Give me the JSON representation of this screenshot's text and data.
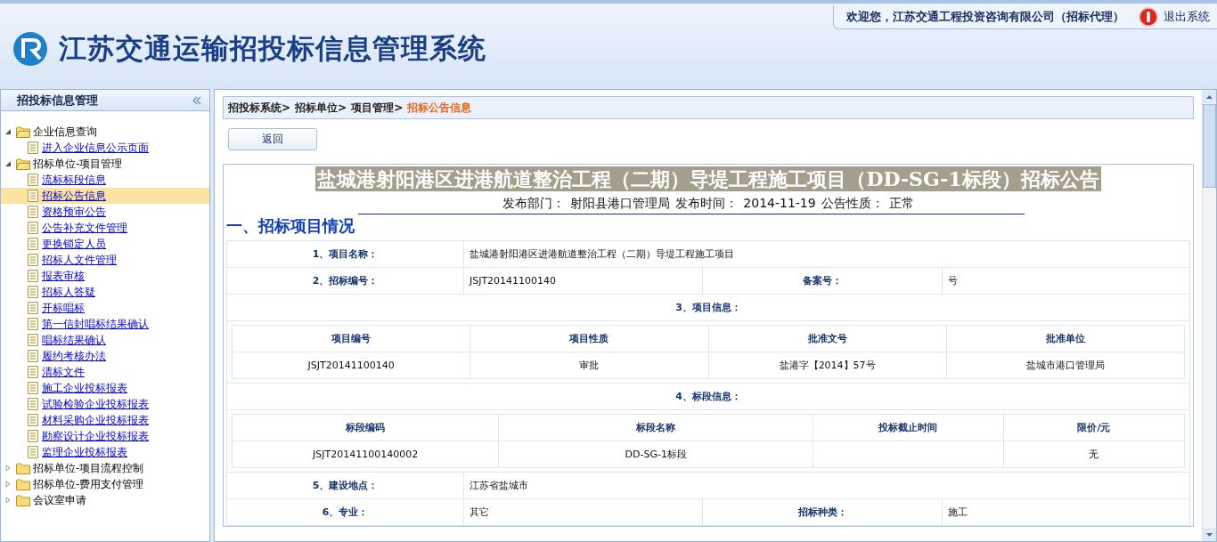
{
  "header": {
    "title": "江苏交通运输招投标信息管理系统",
    "welcome": "欢迎您，江苏交通工程投资咨询有限公司（招标代理）",
    "logout": "退出系统"
  },
  "sidebar": {
    "title": "招投标信息管理",
    "tree": [
      {
        "label": "企业信息查询",
        "expanded": true,
        "children": [
          {
            "label": "进入企业信息公示页面",
            "selected": false
          }
        ]
      },
      {
        "label": "招标单位-项目管理",
        "expanded": true,
        "children": [
          {
            "label": "流标标段信息",
            "selected": false
          },
          {
            "label": "招标公告信息",
            "selected": true
          },
          {
            "label": "资格预审公告",
            "selected": false
          },
          {
            "label": "公告补充文件管理",
            "selected": false
          },
          {
            "label": "更换锁定人员",
            "selected": false
          },
          {
            "label": "招标人文件管理",
            "selected": false
          },
          {
            "label": "报表审核",
            "selected": false
          },
          {
            "label": "招标人答疑",
            "selected": false
          },
          {
            "label": "开标唱标",
            "selected": false
          },
          {
            "label": "第一信封唱标结果确认",
            "selected": false
          },
          {
            "label": "唱标结果确认",
            "selected": false
          },
          {
            "label": "履约考核办法",
            "selected": false
          },
          {
            "label": "清标文件",
            "selected": false
          },
          {
            "label": "施工企业投标报表",
            "selected": false
          },
          {
            "label": "试验检验企业投标报表",
            "selected": false
          },
          {
            "label": "材料采购企业投标报表",
            "selected": false
          },
          {
            "label": "勘察设计企业投标报表",
            "selected": false
          },
          {
            "label": "监理企业投标报表",
            "selected": false
          }
        ]
      },
      {
        "label": "招标单位-项目流程控制",
        "expanded": false
      },
      {
        "label": "招标单位-费用支付管理",
        "expanded": false
      },
      {
        "label": "会议室申请",
        "expanded": false
      }
    ]
  },
  "breadcrumb": [
    {
      "label": "招投标系统>",
      "selected": false
    },
    {
      "label": "招标单位>",
      "selected": false
    },
    {
      "label": "项目管理>",
      "selected": false
    },
    {
      "label": "招标公告信息",
      "selected": true
    }
  ],
  "back_button": "返回",
  "notice": {
    "title": "盐城港射阳港区进港航道整治工程（二期）导堤工程施工项目（DD-SG-1标段）招标公告",
    "meta": [
      {
        "label": "发布部门：",
        "value": "射阳县港口管理局"
      },
      {
        "label": "发布时间：",
        "value": "2014-11-19"
      },
      {
        "label": "公告性质：",
        "value": "正常"
      }
    ],
    "section_heading": "一、招标项目情况",
    "rows": [
      {
        "kind": "field",
        "label": "1、项目名称：",
        "value": "盐城港射阳港区进港航道整治工程（二期）导堤工程施工项目"
      },
      {
        "kind": "field_pair",
        "label": "2、招标编号：",
        "value": "JSJT20141100140",
        "label_2": "备案号：",
        "value_2": "号"
      },
      {
        "kind": "section",
        "label": "3、项目信息："
      },
      {
        "kind": "subtable",
        "columns": [
          "项目编号",
          "项目性质",
          "批准文号",
          "批准单位"
        ],
        "rows": [
          [
            "JSJT20141100140",
            "审批",
            "盐港字【2014】57号",
            "盐城市港口管理局"
          ]
        ]
      },
      {
        "kind": "section",
        "label": "4、标段信息："
      },
      {
        "kind": "subtable",
        "columns": [
          "标段编码",
          "标段名称",
          "投标截止时间",
          "限价/元"
        ],
        "rows": [
          [
            "JSJT20141100140002",
            "DD-SG-1标段",
            "",
            "无"
          ]
        ]
      },
      {
        "kind": "field",
        "label": "5、建设地点：",
        "value": "江苏省盐城市"
      },
      {
        "kind": "field_pair",
        "label": "6、专业：",
        "value": "其它",
        "label_2": "招标种类：",
        "value_2": "施工"
      }
    ]
  }
}
